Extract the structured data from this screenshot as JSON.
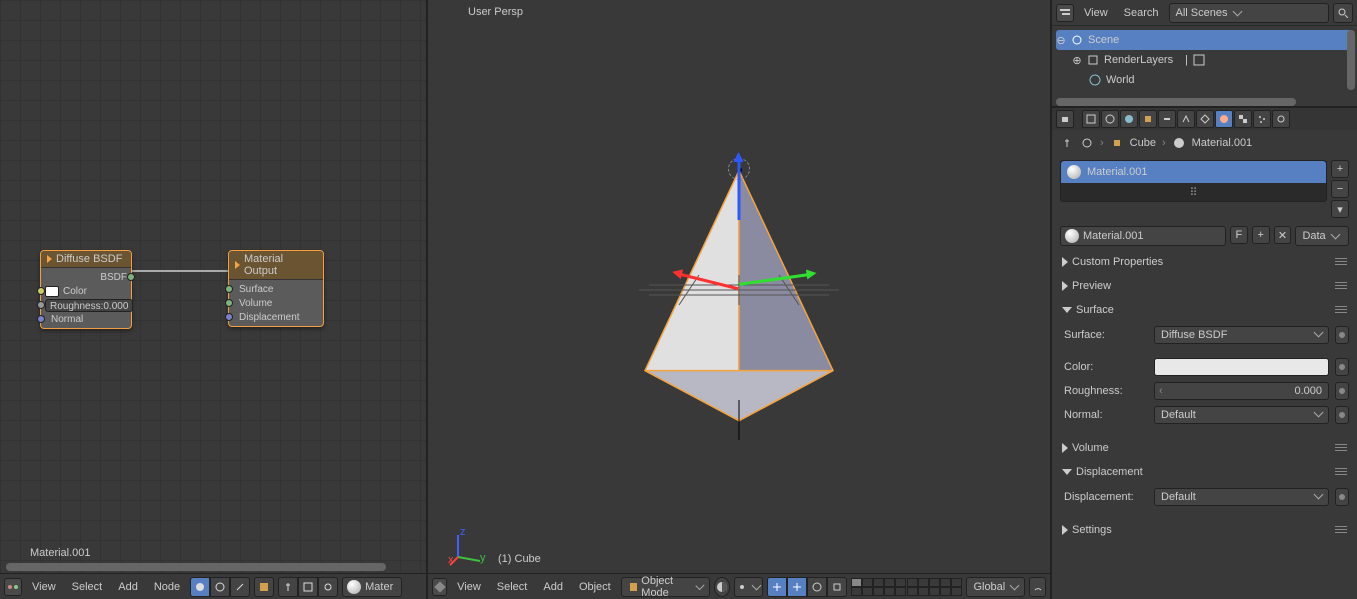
{
  "node_editor": {
    "material_name": "Material.001",
    "nodes": {
      "diffuse": {
        "title": "Diffuse BSDF",
        "out_bsdf": "BSDF",
        "in_color": "Color",
        "roughness": "Roughness:0.000",
        "in_normal": "Normal"
      },
      "output": {
        "title": "Material Output",
        "in_surface": "Surface",
        "in_volume": "Volume",
        "in_disp": "Displacement"
      }
    },
    "header": {
      "view": "View",
      "select": "Select",
      "add": "Add",
      "node": "Node",
      "matfield": "Mater"
    }
  },
  "viewport": {
    "persp": "User Persp",
    "object": "(1) Cube",
    "header": {
      "view": "View",
      "select": "Select",
      "add": "Add",
      "object": "Object",
      "mode": "Object Mode",
      "orient": "Global"
    }
  },
  "outliner": {
    "header": {
      "view": "View",
      "search": "Search",
      "filter": "All Scenes"
    },
    "tree": {
      "scene": "Scene",
      "renderlayers": "RenderLayers",
      "world": "World"
    }
  },
  "properties": {
    "breadcrumb": {
      "obj": "Cube",
      "mat": "Material.001"
    },
    "material_slot": "Material.001",
    "material_id": "Material.001",
    "data_dd": "Data",
    "panels": {
      "custom": "Custom Properties",
      "preview": "Preview",
      "surface": {
        "title": "Surface",
        "surface_label": "Surface:",
        "surface_value": "Diffuse BSDF",
        "color_label": "Color:",
        "rough_label": "Roughness:",
        "rough_value": "0.000",
        "normal_label": "Normal:",
        "normal_value": "Default"
      },
      "volume": "Volume",
      "displacement": {
        "title": "Displacement",
        "label": "Displacement:",
        "value": "Default"
      },
      "settings": "Settings"
    }
  }
}
